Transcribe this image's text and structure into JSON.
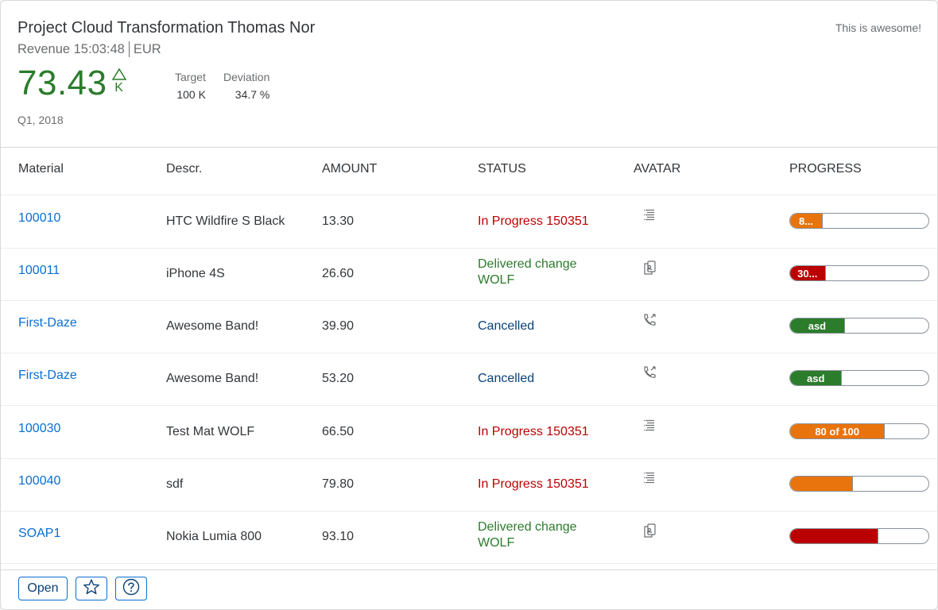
{
  "header": {
    "title": "Project Cloud Transformation Thomas Nor",
    "subtitle": "Revenue 15:03:48",
    "unit": "EUR",
    "status": "This is awesome!",
    "kpi": {
      "value": "73.43",
      "scale": "K",
      "indicator": "up",
      "color": "#2b7c2b"
    },
    "target": {
      "label": "Target",
      "value": "100 K"
    },
    "deviation": {
      "label": "Deviation",
      "value": "34.7 %"
    },
    "details": "Q1, 2018"
  },
  "table": {
    "columns": [
      "Material",
      "Descr.",
      "AMOUNT",
      "STATUS",
      "AVATAR",
      "PROGRESS"
    ],
    "rows": [
      {
        "material": "100010",
        "descr": "HTC Wildfire S Black",
        "amount": "13.30",
        "status": "In Progress 150351",
        "status_state": "error",
        "avatar_icon": "list-icon",
        "progress_text": "8...",
        "progress_percent": 23,
        "progress_color": "#e9730c"
      },
      {
        "material": "100011",
        "descr": "iPhone 4S",
        "amount": "26.60",
        "status": "Delivered change WOLF",
        "status_state": "success",
        "avatar_icon": "documents-icon",
        "progress_text": "30...",
        "progress_percent": 25,
        "progress_color": "#bb0000"
      },
      {
        "material": "First-Daze",
        "descr": "Awesome Band!",
        "amount": "39.90",
        "status": "Cancelled",
        "status_state": "neutral",
        "avatar_icon": "outgoing-call-icon",
        "progress_text": "asd",
        "progress_percent": 39,
        "progress_color": "#2b7c2b"
      },
      {
        "material": "First-Daze",
        "descr": "Awesome Band!",
        "amount": "53.20",
        "status": "Cancelled",
        "status_state": "neutral",
        "avatar_icon": "outgoing-call-icon",
        "progress_text": "asd",
        "progress_percent": 37,
        "progress_color": "#2b7c2b"
      },
      {
        "material": "100030",
        "descr": "Test Mat WOLF",
        "amount": "66.50",
        "status": "In Progress 150351",
        "status_state": "error",
        "avatar_icon": "list-icon",
        "progress_text": "80 of 100",
        "progress_percent": 68,
        "progress_color": "#e9730c"
      },
      {
        "material": "100040",
        "descr": "sdf",
        "amount": "79.80",
        "status": "In Progress 150351",
        "status_state": "error",
        "avatar_icon": "list-icon",
        "progress_text": "",
        "progress_percent": 45,
        "progress_color": "#e9730c"
      },
      {
        "material": "SOAP1",
        "descr": "Nokia Lumia 800",
        "amount": "93.10",
        "status": "Delivered change WOLF",
        "status_state": "success",
        "avatar_icon": "documents-icon",
        "progress_text": "",
        "progress_percent": 63,
        "progress_color": "#bb0000"
      }
    ]
  },
  "footer": {
    "open_label": "Open",
    "favorite_icon": "star-icon",
    "help_icon": "question-mark-icon"
  },
  "colors": {
    "accent": "#0a6ed1",
    "positive": "#2b7c2b",
    "critical": "#e9730c",
    "negative": "#bb0000",
    "neutral": "#0a4177"
  }
}
